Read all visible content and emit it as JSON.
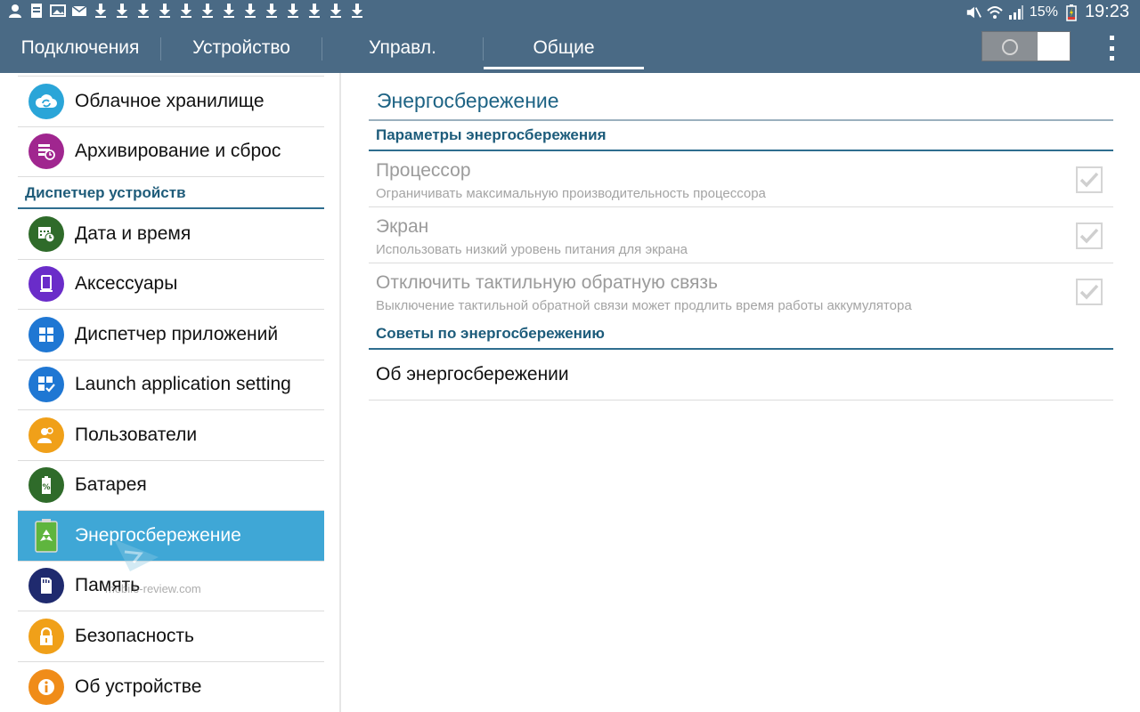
{
  "statusbar": {
    "battery_percent": "15%",
    "time": "19:23"
  },
  "tabs": [
    {
      "label": "Подключения",
      "selected": false
    },
    {
      "label": "Устройство",
      "selected": false
    },
    {
      "label": "Управл.",
      "selected": false
    },
    {
      "label": "Общие",
      "selected": true
    }
  ],
  "sidebar": {
    "items_top": [
      {
        "label": "Облачное хранилище",
        "icon": "cloud-sync-icon",
        "color": "#2aa5d8"
      },
      {
        "label": "Архивирование и сброс",
        "icon": "backup-reset-icon",
        "color": "#a0268f"
      }
    ],
    "section_label": "Диспетчер устройств",
    "items": [
      {
        "label": "Дата и время",
        "icon": "calendar-clock-icon",
        "color": "#2f6b2a"
      },
      {
        "label": "Аксессуары",
        "icon": "tablet-accessory-icon",
        "color": "#6a2cc9"
      },
      {
        "label": "Диспетчер приложений",
        "icon": "app-grid-icon",
        "color": "#1f77d3"
      },
      {
        "label": "Launch application setting",
        "icon": "app-grid-check-icon",
        "color": "#1f77d3"
      },
      {
        "label": "Пользователи",
        "icon": "users-icon",
        "color": "#f0a019"
      },
      {
        "label": "Батарея",
        "icon": "battery-percent-icon",
        "color": "#2f6b2a"
      },
      {
        "label": "Энергосбережение",
        "icon": "recycle-battery-icon",
        "color": "#5fb53e",
        "active": true
      },
      {
        "label": "Память",
        "icon": "sd-card-icon",
        "color": "#1f2a6e"
      },
      {
        "label": "Безопасность",
        "icon": "lock-icon",
        "color": "#f0a019"
      },
      {
        "label": "Об устройстве",
        "icon": "info-icon",
        "color": "#f08c19"
      }
    ]
  },
  "content": {
    "title": "Энергосбережение",
    "section1": "Параметры энергосбережения",
    "options": [
      {
        "title": "Процессор",
        "subtitle": "Ограничивать максимальную производительность процессора",
        "checked": true
      },
      {
        "title": "Экран",
        "subtitle": "Использовать низкий уровень питания для экрана",
        "checked": true
      },
      {
        "title": "Отключить тактильную обратную связь",
        "subtitle": "Выключение тактильной обратной связи может продлить время работы аккумулятора",
        "checked": true
      }
    ],
    "section2": "Советы по энергосбережению",
    "link": "Об энергосбережении"
  },
  "watermark": {
    "text": "mobile-review.com"
  }
}
